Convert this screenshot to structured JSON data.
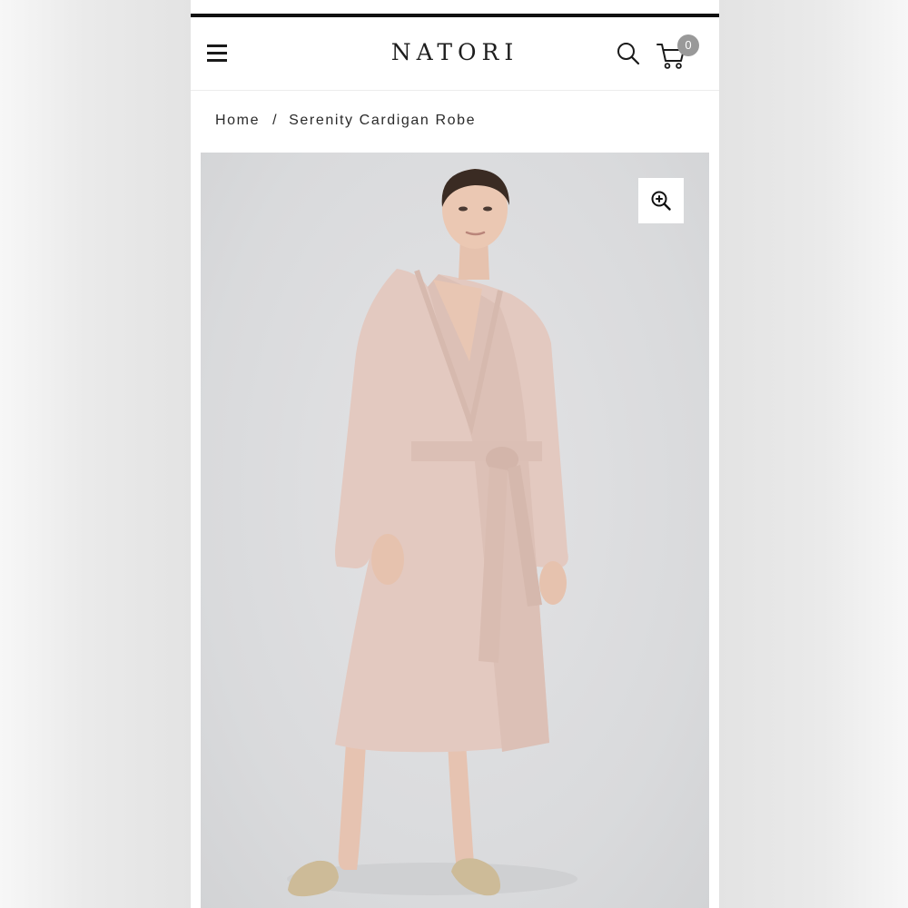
{
  "header": {
    "brand": "NATORI",
    "menu_icon": "hamburger-menu-icon",
    "search_icon": "search-icon",
    "cart_icon": "shopping-cart-icon",
    "cart_count": "0"
  },
  "breadcrumb": {
    "home": "Home",
    "separator": "/",
    "current": "Serenity Cardigan Robe"
  },
  "product": {
    "image_alt": "Model wearing blush pink knit wrap robe with tie belt and beige slippers",
    "zoom_icon": "zoom-in-icon"
  },
  "colors": {
    "text": "#1e1e1e",
    "badge": "#999999",
    "robe": "#e2c8c0",
    "background": "#dadbdd"
  }
}
